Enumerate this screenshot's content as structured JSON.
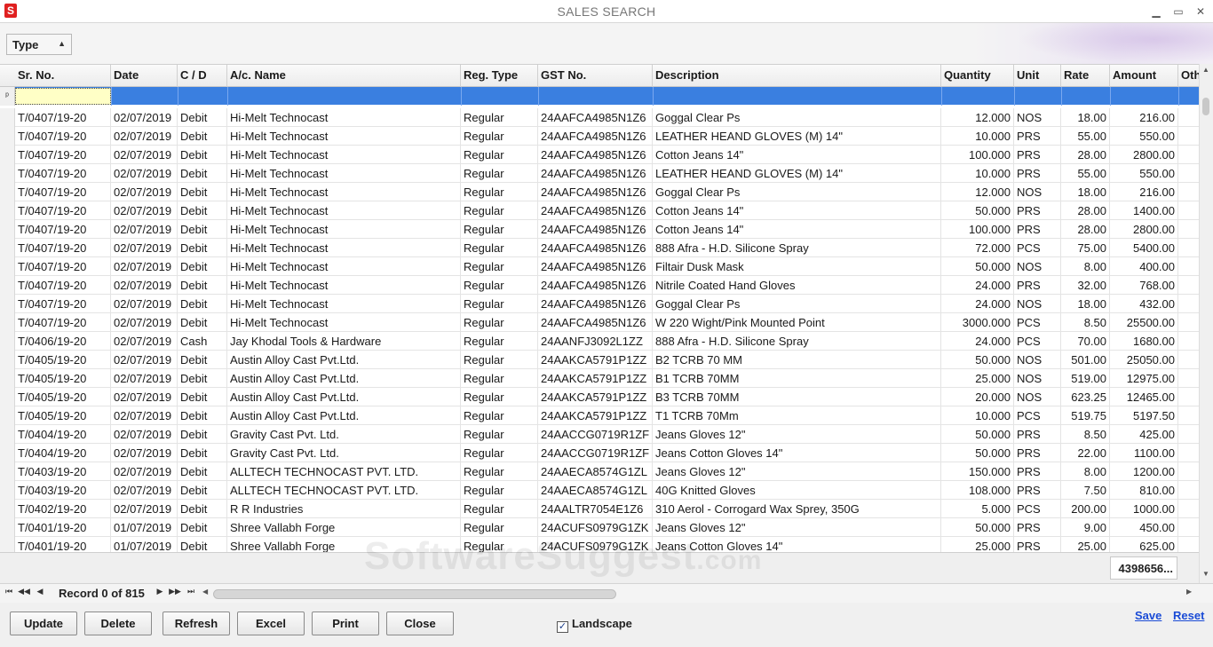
{
  "window": {
    "title": "SALES SEARCH",
    "logo_text": "S",
    "minimize": "▁",
    "maximize": "▭",
    "close": "✕"
  },
  "toolbar": {
    "type_dropdown_label": "Type",
    "caret": "▲"
  },
  "grid": {
    "columns": [
      {
        "key": "sr_no",
        "label": "Sr. No."
      },
      {
        "key": "date",
        "label": "Date"
      },
      {
        "key": "cd",
        "label": "C / D"
      },
      {
        "key": "ac_name",
        "label": "A/c. Name"
      },
      {
        "key": "reg_type",
        "label": "Reg. Type"
      },
      {
        "key": "gst_no",
        "label": "GST No."
      },
      {
        "key": "description",
        "label": "Description"
      },
      {
        "key": "quantity",
        "label": "Quantity"
      },
      {
        "key": "unit",
        "label": "Unit"
      },
      {
        "key": "rate",
        "label": "Rate"
      },
      {
        "key": "amount",
        "label": "Amount"
      },
      {
        "key": "other",
        "label": "Oth"
      }
    ],
    "filter_indicator": "ᵖ",
    "rows": [
      [
        "T/0407/19-20",
        "02/07/2019",
        "Debit",
        "Hi-Melt Technocast",
        "Regular",
        "24AAFCA4985N1Z6",
        "Goggal Clear Ps",
        "12.000",
        "NOS",
        "18.00",
        "216.00"
      ],
      [
        "T/0407/19-20",
        "02/07/2019",
        "Debit",
        "Hi-Melt Technocast",
        "Regular",
        "24AAFCA4985N1Z6",
        "LEATHER HEAND GLOVES (M) 14\"",
        "10.000",
        "PRS",
        "55.00",
        "550.00"
      ],
      [
        "T/0407/19-20",
        "02/07/2019",
        "Debit",
        "Hi-Melt Technocast",
        "Regular",
        "24AAFCA4985N1Z6",
        "Cotton Jeans 14\"",
        "100.000",
        "PRS",
        "28.00",
        "2800.00"
      ],
      [
        "T/0407/19-20",
        "02/07/2019",
        "Debit",
        "Hi-Melt Technocast",
        "Regular",
        "24AAFCA4985N1Z6",
        "LEATHER HEAND GLOVES (M) 14\"",
        "10.000",
        "PRS",
        "55.00",
        "550.00"
      ],
      [
        "T/0407/19-20",
        "02/07/2019",
        "Debit",
        "Hi-Melt Technocast",
        "Regular",
        "24AAFCA4985N1Z6",
        "Goggal Clear Ps",
        "12.000",
        "NOS",
        "18.00",
        "216.00"
      ],
      [
        "T/0407/19-20",
        "02/07/2019",
        "Debit",
        "Hi-Melt Technocast",
        "Regular",
        "24AAFCA4985N1Z6",
        "Cotton Jeans 14\"",
        "50.000",
        "PRS",
        "28.00",
        "1400.00"
      ],
      [
        "T/0407/19-20",
        "02/07/2019",
        "Debit",
        "Hi-Melt Technocast",
        "Regular",
        "24AAFCA4985N1Z6",
        "Cotton Jeans 14\"",
        "100.000",
        "PRS",
        "28.00",
        "2800.00"
      ],
      [
        "T/0407/19-20",
        "02/07/2019",
        "Debit",
        "Hi-Melt Technocast",
        "Regular",
        "24AAFCA4985N1Z6",
        "888 Afra - H.D. Silicone Spray",
        "72.000",
        "PCS",
        "75.00",
        "5400.00"
      ],
      [
        "T/0407/19-20",
        "02/07/2019",
        "Debit",
        "Hi-Melt Technocast",
        "Regular",
        "24AAFCA4985N1Z6",
        "Filtair Dusk Mask",
        "50.000",
        "NOS",
        "8.00",
        "400.00"
      ],
      [
        "T/0407/19-20",
        "02/07/2019",
        "Debit",
        "Hi-Melt Technocast",
        "Regular",
        "24AAFCA4985N1Z6",
        "Nitrile Coated Hand Gloves",
        "24.000",
        "PRS",
        "32.00",
        "768.00"
      ],
      [
        "T/0407/19-20",
        "02/07/2019",
        "Debit",
        "Hi-Melt Technocast",
        "Regular",
        "24AAFCA4985N1Z6",
        "Goggal Clear Ps",
        "24.000",
        "NOS",
        "18.00",
        "432.00"
      ],
      [
        "T/0407/19-20",
        "02/07/2019",
        "Debit",
        "Hi-Melt Technocast",
        "Regular",
        "24AAFCA4985N1Z6",
        "W 220 Wight/Pink Mounted Point",
        "3000.000",
        "PCS",
        "8.50",
        "25500.00"
      ],
      [
        "T/0406/19-20",
        "02/07/2019",
        "Cash",
        "Jay Khodal Tools & Hardware",
        "Regular",
        "24AANFJ3092L1ZZ",
        "888 Afra - H.D. Silicone Spray",
        "24.000",
        "PCS",
        "70.00",
        "1680.00"
      ],
      [
        "T/0405/19-20",
        "02/07/2019",
        "Debit",
        "Austin Alloy  Cast Pvt.Ltd.",
        "Regular",
        "24AAKCA5791P1ZZ",
        "B2 TCRB 70 MM",
        "50.000",
        "NOS",
        "501.00",
        "25050.00"
      ],
      [
        "T/0405/19-20",
        "02/07/2019",
        "Debit",
        "Austin Alloy  Cast Pvt.Ltd.",
        "Regular",
        "24AAKCA5791P1ZZ",
        "B1 TCRB 70MM",
        "25.000",
        "NOS",
        "519.00",
        "12975.00"
      ],
      [
        "T/0405/19-20",
        "02/07/2019",
        "Debit",
        "Austin Alloy  Cast Pvt.Ltd.",
        "Regular",
        "24AAKCA5791P1ZZ",
        "B3 TCRB 70MM",
        "20.000",
        "NOS",
        "623.25",
        "12465.00"
      ],
      [
        "T/0405/19-20",
        "02/07/2019",
        "Debit",
        "Austin Alloy  Cast Pvt.Ltd.",
        "Regular",
        "24AAKCA5791P1ZZ",
        "T1 TCRB 70Mm",
        "10.000",
        "PCS",
        "519.75",
        "5197.50"
      ],
      [
        "T/0404/19-20",
        "02/07/2019",
        "Debit",
        "Gravity Cast Pvt. Ltd.",
        "Regular",
        "24AACCG0719R1ZF",
        "Jeans Gloves 12\"",
        "50.000",
        "PRS",
        "8.50",
        "425.00"
      ],
      [
        "T/0404/19-20",
        "02/07/2019",
        "Debit",
        "Gravity Cast Pvt. Ltd.",
        "Regular",
        "24AACCG0719R1ZF",
        "Jeans Cotton Gloves 14\"",
        "50.000",
        "PRS",
        "22.00",
        "1100.00"
      ],
      [
        "T/0403/19-20",
        "02/07/2019",
        "Debit",
        "ALLTECH TECHNOCAST PVT. LTD.",
        "Regular",
        "24AAECA8574G1ZL",
        "Jeans Gloves 12\"",
        "150.000",
        "PRS",
        "8.00",
        "1200.00"
      ],
      [
        "T/0403/19-20",
        "02/07/2019",
        "Debit",
        "ALLTECH TECHNOCAST PVT. LTD.",
        "Regular",
        "24AAECA8574G1ZL",
        "40G Knitted Gloves",
        "108.000",
        "PRS",
        "7.50",
        "810.00"
      ],
      [
        "T/0402/19-20",
        "02/07/2019",
        "Debit",
        "R R Industries",
        "Regular",
        "24AALTR7054E1Z6",
        "310 Aerol - Corrogard Wax Sprey, 350G",
        "5.000",
        "PCS",
        "200.00",
        "1000.00"
      ],
      [
        "T/0401/19-20",
        "01/07/2019",
        "Debit",
        "Shree Vallabh Forge",
        "Regular",
        "24ACUFS0979G1ZK",
        "Jeans Gloves 12\"",
        "50.000",
        "PRS",
        "9.00",
        "450.00"
      ],
      [
        "T/0401/19-20",
        "01/07/2019",
        "Debit",
        "Shree Vallabh Forge",
        "Regular",
        "24ACUFS0979G1ZK",
        "Jeans Cotton Gloves 14\"",
        "25.000",
        "PRS",
        "25.00",
        "625.00"
      ]
    ],
    "amount_total": "4398656..."
  },
  "navigator": {
    "first": "⏮",
    "prev_page": "◀◀",
    "prev": "◀",
    "record_label": "Record 0 of 815",
    "next": "▶",
    "next_page": "▶▶",
    "last": "⏭",
    "scroll_left": "◀",
    "scroll_right": "▶"
  },
  "watermark": {
    "main": "SoftwareSuggest",
    "suffix": ".com"
  },
  "actions": {
    "update": "Update",
    "delete": "Delete",
    "refresh": "Refresh",
    "excel": "Excel",
    "print": "Print",
    "close": "Close",
    "landscape_label": "Landscape",
    "landscape_checked": "✓",
    "save_link": "Save",
    "reset_link": "Reset"
  }
}
